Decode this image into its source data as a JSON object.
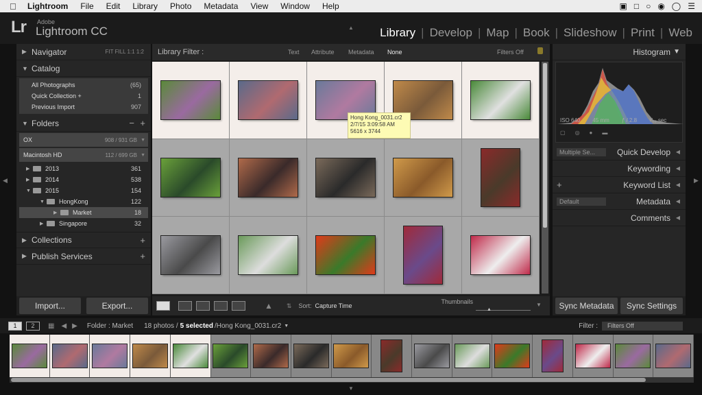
{
  "menubar": {
    "items": [
      "Lightroom",
      "File",
      "Edit",
      "Library",
      "Photo",
      "Metadata",
      "View",
      "Window",
      "Help"
    ]
  },
  "header": {
    "logo": "Lr",
    "brand_small": "Adobe",
    "brand": "Lightroom CC",
    "modules": [
      "Library",
      "Develop",
      "Map",
      "Book",
      "Slideshow",
      "Print",
      "Web"
    ],
    "active_module": "Library"
  },
  "left": {
    "navigator": {
      "label": "Navigator",
      "options": "FIT   FILL   1:1   1:2"
    },
    "catalog": {
      "label": "Catalog",
      "items": [
        {
          "label": "All Photographs",
          "count": "(65)"
        },
        {
          "label": "Quick Collection +",
          "count": "1"
        },
        {
          "label": "Previous Import",
          "count": "907"
        }
      ]
    },
    "folders": {
      "label": "Folders",
      "volumes": [
        {
          "label": "OX",
          "info": "908 / 931 GB"
        },
        {
          "label": "Macintosh HD",
          "info": "112 / 699 GB"
        }
      ],
      "tree": [
        {
          "label": "2013",
          "count": "361"
        },
        {
          "label": "2014",
          "count": "538"
        },
        {
          "label": "2015",
          "count": "154"
        },
        {
          "label": "HongKong",
          "count": "122"
        },
        {
          "label": "Market",
          "count": "18"
        },
        {
          "label": "Singapore",
          "count": "32"
        }
      ]
    },
    "collections": "Collections",
    "publish": "Publish Services",
    "import": "Import...",
    "export": "Export..."
  },
  "filter": {
    "label": "Library Filter :",
    "items": [
      "Text",
      "Attribute",
      "Metadata",
      "None"
    ],
    "status": "Filters Off"
  },
  "tooltip": {
    "line1": "Hong Kong_0031.cr2",
    "line2": "2/7/15 3:09:58 AM",
    "line3": "5616 x 3744"
  },
  "toolbar": {
    "sort_label": "Sort:",
    "sort_value": "Capture Time",
    "thumbs_label": "Thumbnails"
  },
  "right": {
    "histogram": "Histogram",
    "exif": [
      "ISO 640",
      "45 mm",
      "ƒ / 2.8",
      "¹⁄₆₀ sec"
    ],
    "quick_develop": "Quick Develop",
    "qd_preset": "Multiple Se...",
    "keywording": "Keywording",
    "keyword_list": "Keyword List",
    "metadata": "Metadata",
    "md_preset": "Default",
    "comments": "Comments",
    "sync_metadata": "Sync Metadata",
    "sync_settings": "Sync Settings"
  },
  "filmstrip_bar": {
    "pages": [
      "1",
      "2"
    ],
    "folder": "Folder : Market",
    "count": "18 photos /",
    "selected": "5 selected",
    "file": "/Hong Kong_0031.cr2",
    "filter_label": "Filter :",
    "filter_value": "Filters Off"
  },
  "colors": {
    "selected_cell": "#f4eeea",
    "cell": "#a8a8a8",
    "panel": "#262626"
  },
  "thumbs": [
    {
      "c1": "#5a8a3a",
      "c2": "#9a6aa0",
      "wide": true,
      "sel": true
    },
    {
      "c1": "#5a6a8a",
      "c2": "#b06a70",
      "wide": true,
      "sel": true
    },
    {
      "c1": "#6a7a9a",
      "c2": "#b07aa0",
      "wide": true,
      "sel": true
    },
    {
      "c1": "#c08a4a",
      "c2": "#7a5a3a",
      "wide": true,
      "sel": true
    },
    {
      "c1": "#4a8a3a",
      "c2": "#e0e0e0",
      "wide": true,
      "sel": true
    },
    {
      "c1": "#6aa03a",
      "c2": "#2a4a2a",
      "wide": true,
      "sel": false
    },
    {
      "c1": "#b06a4a",
      "c2": "#3a2a2a",
      "wide": true,
      "sel": false
    },
    {
      "c1": "#7a6a5a",
      "c2": "#2a2a2a",
      "wide": true,
      "sel": false
    },
    {
      "c1": "#d09a4a",
      "c2": "#8a5a2a",
      "wide": true,
      "sel": false
    },
    {
      "c1": "#8a2a2a",
      "c2": "#4a3a2a",
      "wide": false,
      "sel": false
    },
    {
      "c1": "#9a9aa0",
      "c2": "#4a4a4a",
      "wide": true,
      "sel": false
    },
    {
      "c1": "#6a9a5a",
      "c2": "#dddddd",
      "wide": true,
      "sel": false
    },
    {
      "c1": "#e03a1a",
      "c2": "#3a7a2a",
      "wide": true,
      "sel": false
    },
    {
      "c1": "#a02a3a",
      "c2": "#6a4a8a",
      "wide": false,
      "sel": false
    },
    {
      "c1": "#c02a4a",
      "c2": "#eeeeee",
      "wide": true,
      "sel": false
    }
  ]
}
